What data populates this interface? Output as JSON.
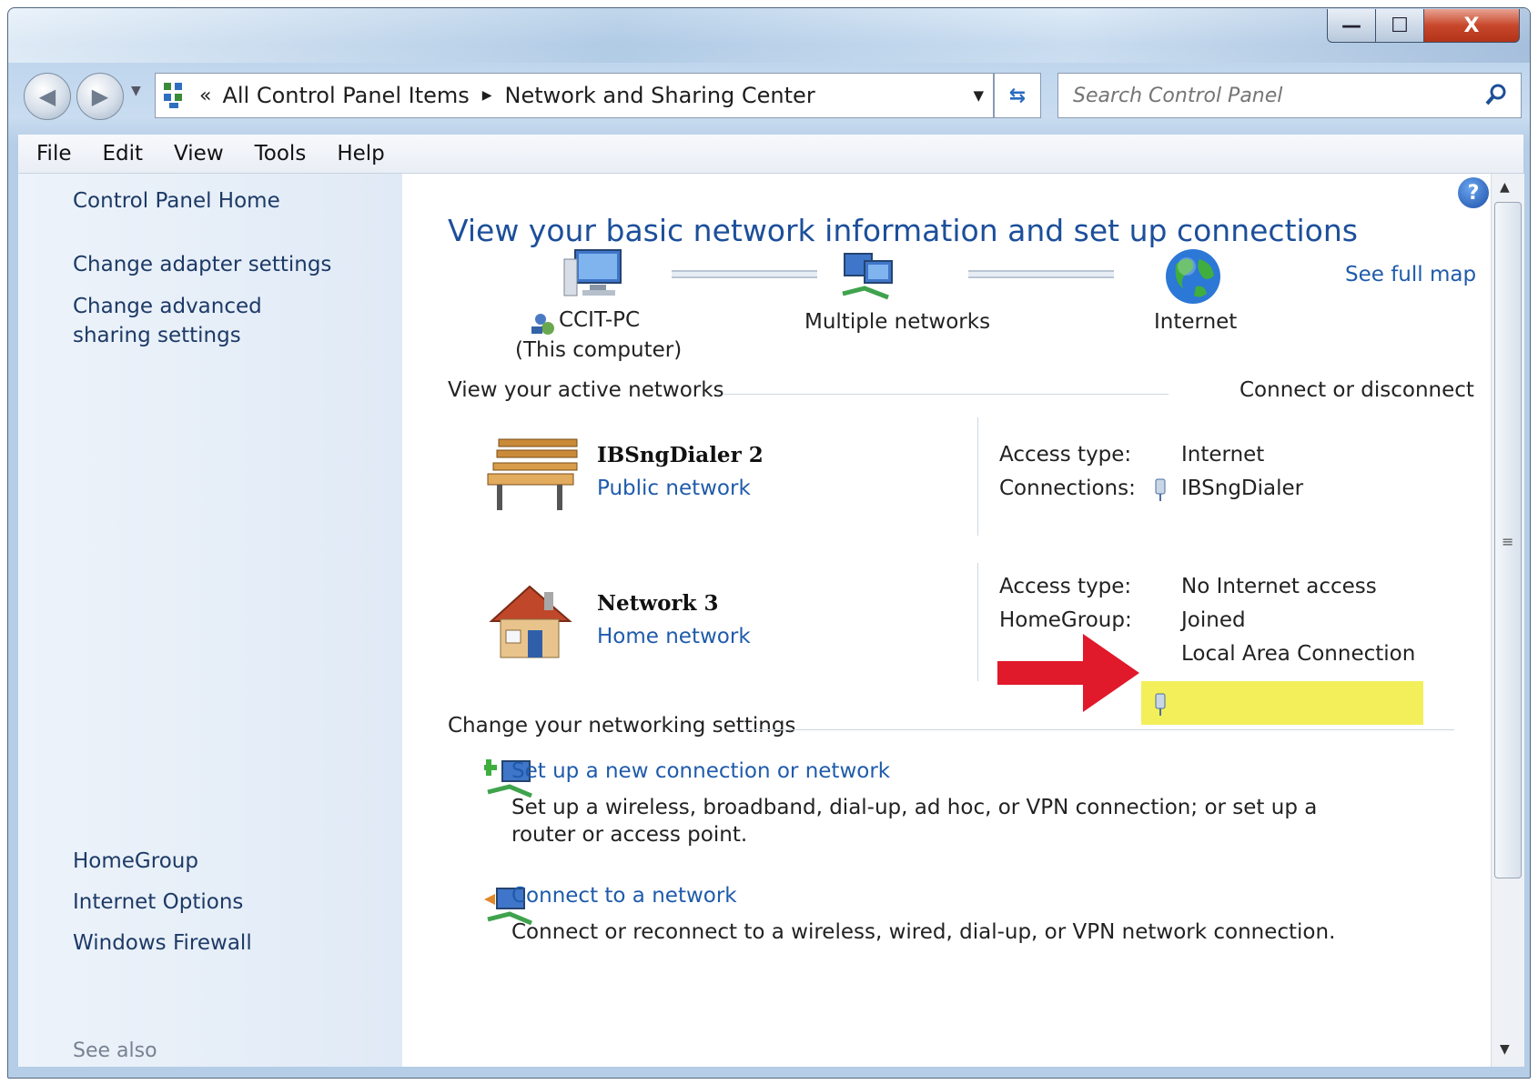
{
  "window": {
    "minimize_glyph": "—",
    "maximize_glyph": "☐",
    "close_glyph": "X"
  },
  "navigation": {
    "back_icon": "back-arrow-icon",
    "forward_icon": "forward-arrow-icon",
    "breadcrumb_overflow": "«",
    "breadcrumb": [
      "All Control Panel Items",
      "Network and Sharing Center"
    ],
    "search_placeholder": "Search Control Panel"
  },
  "menu": [
    "File",
    "Edit",
    "View",
    "Tools",
    "Help"
  ],
  "sidebar": {
    "links": [
      "Control Panel Home",
      "Change adapter settings",
      "Change advanced sharing settings"
    ],
    "see_also_label": "See also",
    "see_also_links": [
      "HomeGroup",
      "Internet Options",
      "Windows Firewall"
    ]
  },
  "main": {
    "title": "View your basic network information and set up connections",
    "see_full_map": "See full map",
    "map": {
      "computer_name": "CCIT-PC",
      "computer_sub": "(This computer)",
      "middle": "Multiple networks",
      "internet": "Internet"
    },
    "active_networks": {
      "heading": "View your active networks",
      "action": "Connect or disconnect",
      "networks": [
        {
          "name": "IBSngDialer  2",
          "type": "Public network",
          "access_label": "Access type:",
          "access_value": "Internet",
          "conn_label": "Connections:",
          "conn_value": "IBSngDialer"
        },
        {
          "name": "Network  3",
          "type": "Home network",
          "access_label": "Access type:",
          "access_value": "No Internet access",
          "homegroup_label": "HomeGroup:",
          "homegroup_value": "Joined",
          "conn_value": "Local Area Connection"
        }
      ]
    },
    "settings": {
      "heading": "Change your networking settings",
      "tasks": [
        {
          "link": "Set up a new connection or network",
          "desc": "Set up a wireless, broadband, dial-up, ad hoc, or VPN connection; or set up a router or access point."
        },
        {
          "link": "Connect to a network",
          "desc": "Connect or reconnect to a wireless, wired, dial-up, or VPN network connection."
        }
      ]
    }
  },
  "annotation": {
    "arrow_color": "#e0192b",
    "highlight_color": "#f3ef5a"
  }
}
